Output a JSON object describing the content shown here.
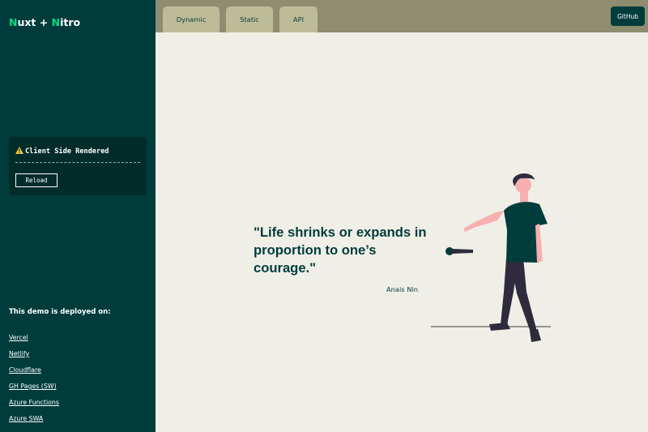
{
  "sidebar": {
    "logo": {
      "part1": "Nuxt",
      "plus": " + ",
      "part2": "Nitro",
      "initial_color": "#00dc82"
    },
    "render_card": {
      "icon": "warning-icon",
      "title": "Client Side Rendered",
      "reload_label": "Reload"
    },
    "deploy": {
      "heading": "This demo is deployed on:",
      "links": [
        "Vercel",
        "Netlify",
        "Cloudflare",
        "GH Pages (SW)",
        "Azure Functions",
        "Azure SWA"
      ]
    }
  },
  "header": {
    "tabs": [
      "Dynamic",
      "Static",
      "API"
    ],
    "github_label": "GitHub"
  },
  "main": {
    "quote": "\"Life shrinks or expands in proportion to one’s courage.\"",
    "author": "Anais Nin",
    "illustration": "person-dropping-microphone"
  },
  "colors": {
    "sidebar_bg": "#003c3c",
    "accent": "#00dc82",
    "topbar_bg": "#8e8d6f",
    "tab_bg": "#bcbc99",
    "content_bg": "#f0efe7"
  }
}
